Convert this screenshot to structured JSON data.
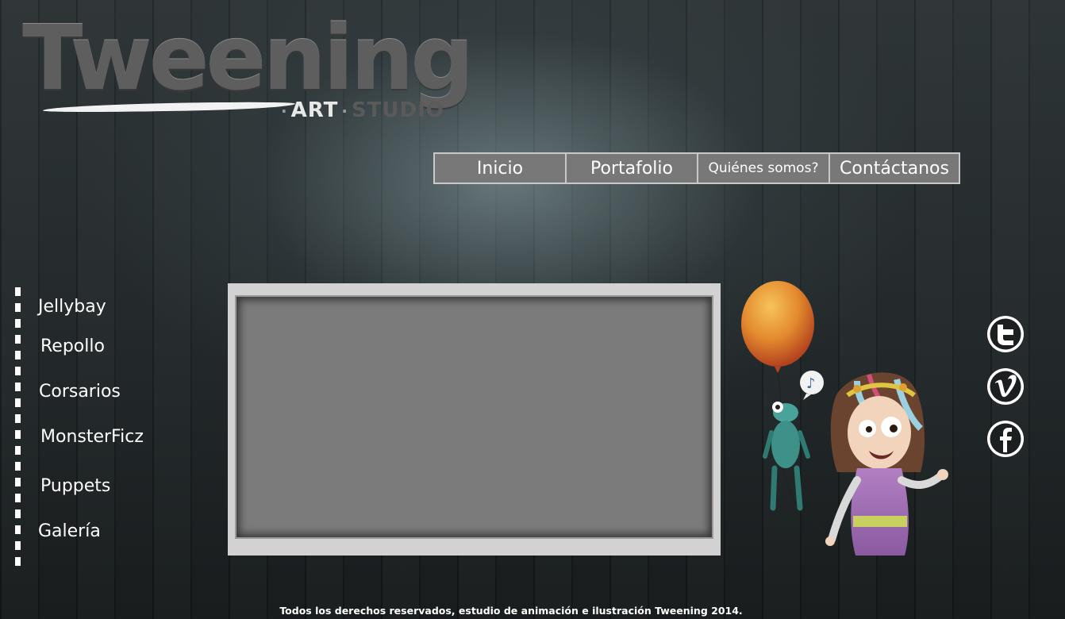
{
  "logo": {
    "title": "Tweening",
    "sub_art": "ART",
    "sub_studio": "STUDIO",
    "separator": "·"
  },
  "topnav": {
    "items": [
      {
        "label": "Inicio"
      },
      {
        "label": "Portafolio"
      },
      {
        "label": "Quiénes somos?"
      },
      {
        "label": "Contáctanos"
      }
    ]
  },
  "sidebar": {
    "items": [
      {
        "label": "Jellybay"
      },
      {
        "label": "Repollo"
      },
      {
        "label": "Corsarios"
      },
      {
        "label": "MonsterFicz"
      },
      {
        "label": "Puppets"
      },
      {
        "label": "Galería"
      }
    ]
  },
  "social": {
    "icons": [
      "twitter-icon",
      "vimeo-icon",
      "facebook-icon"
    ]
  },
  "footer": {
    "text": "Todos los derechos reservados, estudio de animación e ilustración Tweening 2014."
  },
  "colors": {
    "nav_bg": "#787878",
    "nav_border": "#c9c9c9",
    "video_frame": "#d2d2d2",
    "video_screen": "#7b7b7b",
    "logo_gray": "#5e5e5e"
  }
}
